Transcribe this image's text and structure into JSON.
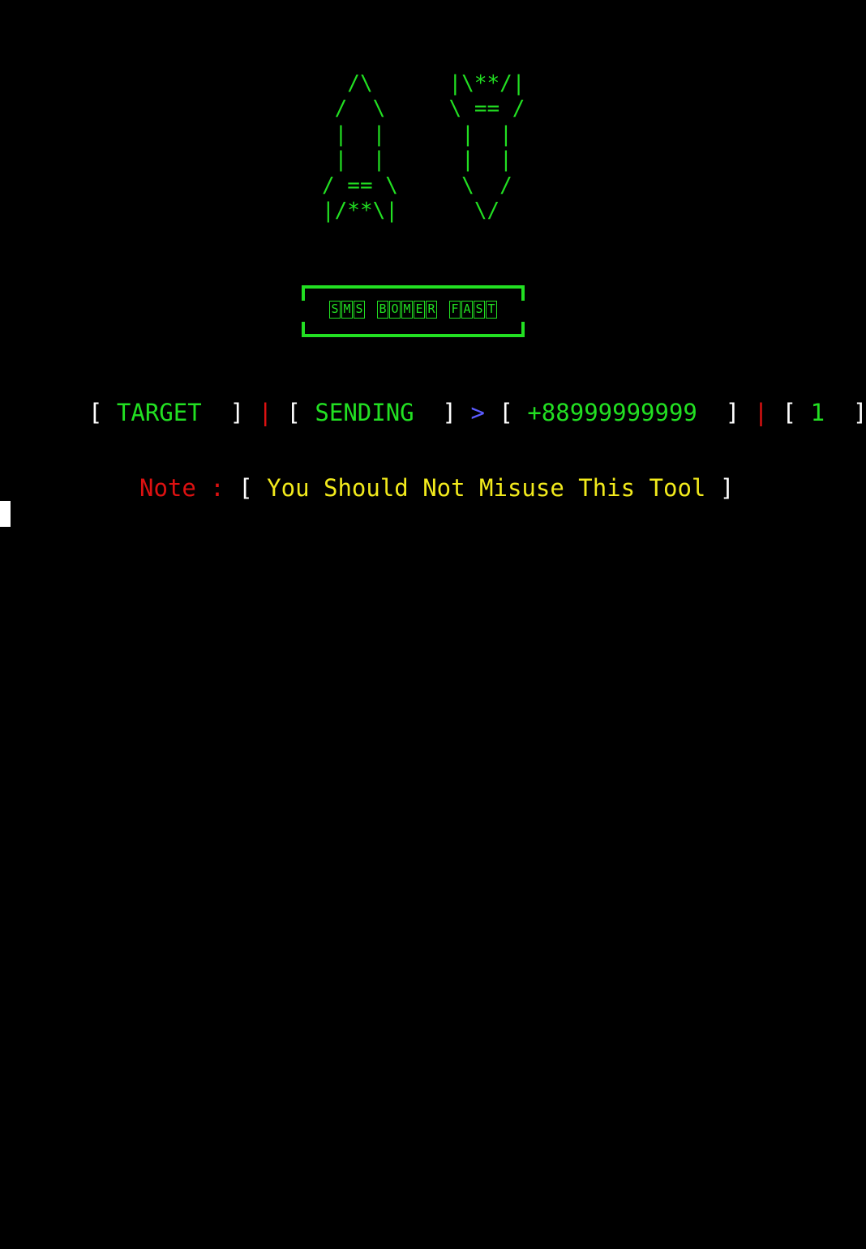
{
  "ascii_rockets": {
    "lines": [
      "  /\\      |\\**/|",
      " /  \\     \\ == /",
      " |  |      |  |",
      " |  |      |  |",
      "/ == \\     \\  /",
      "|/**\\|      \\/"
    ]
  },
  "banner": {
    "words": [
      [
        "S",
        "M",
        "S"
      ],
      [
        "B",
        "O",
        "M",
        "E",
        "R"
      ],
      [
        "F",
        "A",
        "S",
        "T"
      ]
    ]
  },
  "status": {
    "open_bracket": "[",
    "target_label": " TARGET ",
    "close_bracket": " ]",
    "separator": "|",
    "sending_label": " SENDING ",
    "arrow": ">",
    "phone_number": " +88999999999 ",
    "count": " 1 "
  },
  "note": {
    "label": "Note : ",
    "open_bracket": "[",
    "message": " You Should Not Misuse This Tool ",
    "close_bracket": "]"
  },
  "colors": {
    "background": "#000000",
    "green": "#22e022",
    "red": "#dd1111",
    "blue": "#5b5bff",
    "yellow": "#f2ea1c",
    "white": "#ffffff"
  }
}
